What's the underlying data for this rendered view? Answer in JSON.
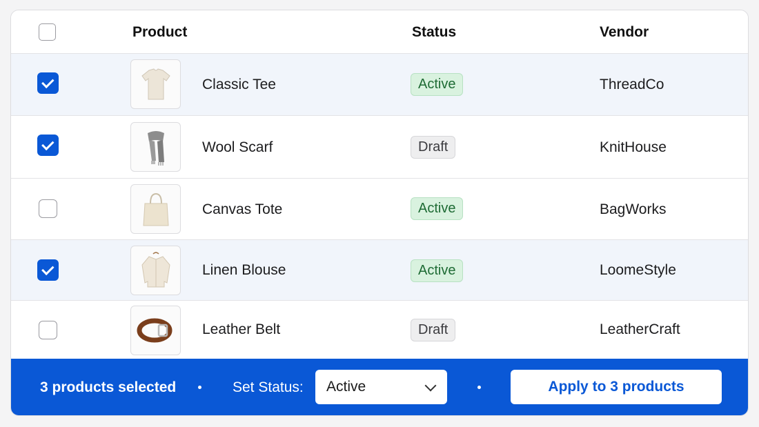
{
  "table": {
    "columns": {
      "product": "Product",
      "status": "Status",
      "vendor": "Vendor"
    },
    "header_checkbox_checked": false,
    "rows": [
      {
        "checked": true,
        "product": "Classic Tee",
        "status": "Active",
        "vendor": "ThreadCo",
        "thumb_icon": "tshirt-icon"
      },
      {
        "checked": true,
        "product": "Wool Scarf",
        "status": "Draft",
        "vendor": "KnitHouse",
        "thumb_icon": "scarf-icon"
      },
      {
        "checked": false,
        "product": "Canvas Tote",
        "status": "Active",
        "vendor": "BagWorks",
        "thumb_icon": "tote-bag-icon"
      },
      {
        "checked": true,
        "product": "Linen Blouse",
        "status": "Active",
        "vendor": "LoomeStyle",
        "thumb_icon": "blouse-icon"
      },
      {
        "checked": false,
        "product": "Leather Belt",
        "status": "Draft",
        "vendor": "LeatherCraft",
        "thumb_icon": "belt-icon"
      }
    ]
  },
  "bulk_bar": {
    "selected_text": "3 products selected",
    "set_status_label": "Set Status:",
    "status_select_value": "Active",
    "apply_label": "Apply to 3 products"
  },
  "colors": {
    "accent": "#0a58d6",
    "active_badge_bg": "#d9f2df",
    "active_badge_text": "#1e6b34",
    "draft_badge_bg": "#eeeeef",
    "selected_row_bg": "#f1f5fb"
  }
}
